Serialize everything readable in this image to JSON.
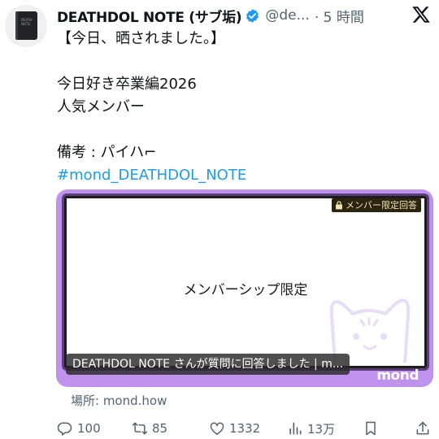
{
  "author": {
    "display_name": "DEATHDOL NOTE (サブ垢)",
    "handle": "@de...",
    "time": "· 5 時間",
    "avatar_label": "DEATH NOTE"
  },
  "tweet": {
    "lines": [
      "【今日、晒されました。】",
      "",
      "今日好き卒業編2026",
      "人気メンバー",
      "",
      "備考 : パイハ⌐"
    ],
    "hashtag": "#mond_DEATHDOL_NOTE"
  },
  "card": {
    "badge": "メンバー限定回答",
    "center_text": "メンバーシップ限定",
    "caption": "DEATHDOL NOTE さんが質問に回答しました | m...",
    "brand": "mond",
    "frame_color": "#bf92ee"
  },
  "source": "場所: mond.how",
  "actions": {
    "replies": "100",
    "reposts": "85",
    "likes": "1332",
    "views": "13万"
  },
  "colors": {
    "accent": "#1d9bf0",
    "muted": "#536471"
  },
  "icons": [
    "verified-badge-icon",
    "x-logo-icon",
    "lock-icon",
    "reply-icon",
    "repost-icon",
    "like-icon",
    "views-icon",
    "bookmark-icon",
    "share-icon"
  ]
}
